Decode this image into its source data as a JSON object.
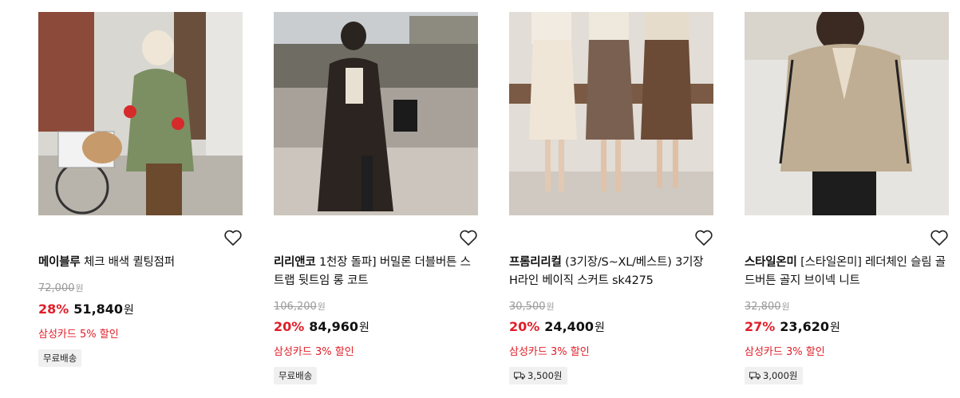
{
  "products": [
    {
      "brand": "메이블루",
      "name": " 체크 배색 퀼팅점퍼",
      "original_price": "72,000",
      "discount": "28%",
      "price": "51,840",
      "won": "원",
      "card_benefit": "삼성카드 5% 할인",
      "shipping": "무료배송"
    },
    {
      "brand": "리리앤코",
      "name": " 1천장 돌파] 버밀론 더블버튼 스트랩 뒷트임 롱 코트",
      "original_price": "106,200",
      "discount": "20%",
      "price": "84,960",
      "won": "원",
      "card_benefit": "삼성카드 3% 할인",
      "shipping": "무료배송"
    },
    {
      "brand": "프롬리리컬",
      "name": " (3기장/S~XL/베스트) 3기장 H라인 베이직 스커트 sk4275",
      "original_price": "30,500",
      "discount": "20%",
      "price": "24,400",
      "won": "원",
      "card_benefit": "삼성카드 3% 할인",
      "shipping": "3,500원",
      "shipping_icon": "truck-icon"
    },
    {
      "brand": "스타일온미",
      "name": " [스타일온미] 레더체인 슬림 골드버튼 골지 브이넥 니트",
      "original_price": "32,800",
      "discount": "27%",
      "price": "23,620",
      "won": "원",
      "card_benefit": "삼성카드 3% 할인",
      "shipping": "3,000원",
      "shipping_icon": "truck-icon"
    }
  ],
  "colors": {
    "discount": "#e01e28",
    "strike": "#9a9a9a",
    "ship_bg": "#f0f0f0"
  }
}
